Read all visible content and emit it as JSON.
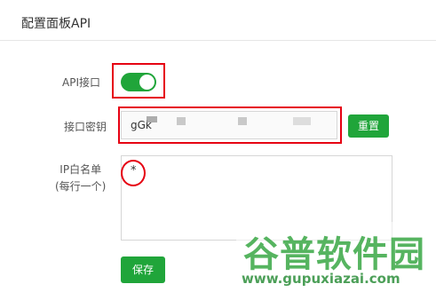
{
  "dialog": {
    "title": "配置面板API"
  },
  "form": {
    "api_label": "API接口",
    "api_enabled": true,
    "key_label": "接口密钥",
    "key_value": "gGk",
    "reset_label": "重置",
    "ip_label_line1": "IP白名单",
    "ip_label_line2": "(每行一个)",
    "ip_value": "*",
    "save_label": "保存"
  },
  "watermark": {
    "logo": "谷普软件园",
    "url": "www.gupuxiazai.com"
  },
  "colors": {
    "accent": "#20a53a",
    "highlight": "#e60012"
  },
  "icons": {
    "toggle": "toggle-switch-on"
  }
}
